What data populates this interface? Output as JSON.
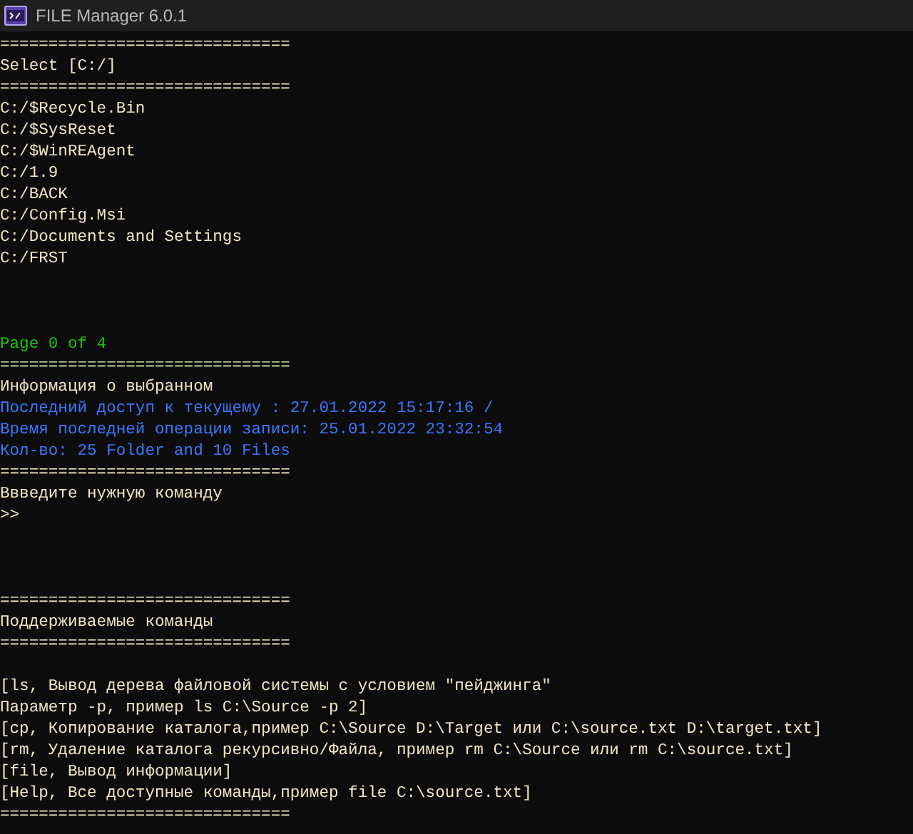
{
  "window": {
    "title": "FILE Manager 6.0.1"
  },
  "lines": [
    {
      "kind": "line",
      "text": "==============================",
      "color": "#f1e6c3"
    },
    {
      "kind": "line",
      "text": "Select [C:/]",
      "color": "#f1e6c3"
    },
    {
      "kind": "line",
      "text": "==============================",
      "color": "#f1e6c3"
    },
    {
      "kind": "line",
      "text": "C:/$Recycle.Bin",
      "color": "#f1e6c3"
    },
    {
      "kind": "line",
      "text": "C:/$SysReset",
      "color": "#f1e6c3"
    },
    {
      "kind": "line",
      "text": "C:/$WinREAgent",
      "color": "#f1e6c3"
    },
    {
      "kind": "line",
      "text": "C:/1.9",
      "color": "#f1e6c3"
    },
    {
      "kind": "line",
      "text": "C:/BACK",
      "color": "#f1e6c3"
    },
    {
      "kind": "line",
      "text": "C:/Config.Msi",
      "color": "#f1e6c3"
    },
    {
      "kind": "line",
      "text": "C:/Documents and Settings",
      "color": "#f1e6c3"
    },
    {
      "kind": "line",
      "text": "C:/FRST",
      "color": "#f1e6c3"
    },
    {
      "kind": "blank"
    },
    {
      "kind": "blank"
    },
    {
      "kind": "blank"
    },
    {
      "kind": "line",
      "text": "Page 0 of 4",
      "color": "#16c60c"
    },
    {
      "kind": "line",
      "text": "==============================",
      "color": "#c9e4a6"
    },
    {
      "kind": "line",
      "text": "Информация о выбранном",
      "color": "#f1e6c3"
    },
    {
      "kind": "line",
      "text": "Последний доступ к текущему : 27.01.2022 15:17:16 /",
      "color": "#3b78ff"
    },
    {
      "kind": "line",
      "text": "Время последней операции записи: 25.01.2022 23:32:54",
      "color": "#3b78ff"
    },
    {
      "kind": "line",
      "text": "Кол-во: 25 Folder and 10 Files",
      "color": "#3b78ff"
    },
    {
      "kind": "line",
      "text": "==============================",
      "color": "#f1e6c3"
    },
    {
      "kind": "line",
      "text": "Ввведите нужную команду",
      "color": "#f1e6c3"
    },
    {
      "kind": "line",
      "text": ">>",
      "color": "#f1e6c3"
    },
    {
      "kind": "blank"
    },
    {
      "kind": "blank"
    },
    {
      "kind": "blank"
    },
    {
      "kind": "line",
      "text": "==============================",
      "color": "#f1e6c3"
    },
    {
      "kind": "line",
      "text": "Поддерживаемые команды",
      "color": "#f1e6c3"
    },
    {
      "kind": "line",
      "text": "==============================",
      "color": "#f1e6c3"
    },
    {
      "kind": "blank"
    },
    {
      "kind": "line",
      "text": "[ls, Вывод дерева файловой системы с условием \"пейджинга\"",
      "color": "#f1e6c3"
    },
    {
      "kind": "line",
      "text": "Параметр -p, пример ls C:\\Source -p 2]",
      "color": "#f1e6c3"
    },
    {
      "kind": "line",
      "text": "[cp, Копирование каталога,пример C:\\Source D:\\Target или C:\\source.txt D:\\target.txt]",
      "color": "#f1e6c3"
    },
    {
      "kind": "line",
      "text": "[rm, Удаление каталога рекурсивно/Файла, пример rm C:\\Source или rm C:\\source.txt]",
      "color": "#f1e6c3"
    },
    {
      "kind": "line",
      "text": "[file, Вывод информации]",
      "color": "#f1e6c3"
    },
    {
      "kind": "line",
      "text": "[Help, Все доступные команды,пример file C:\\source.txt]",
      "color": "#f1e6c3"
    },
    {
      "kind": "line",
      "text": "==============================",
      "color": "#f1e6c3"
    }
  ]
}
